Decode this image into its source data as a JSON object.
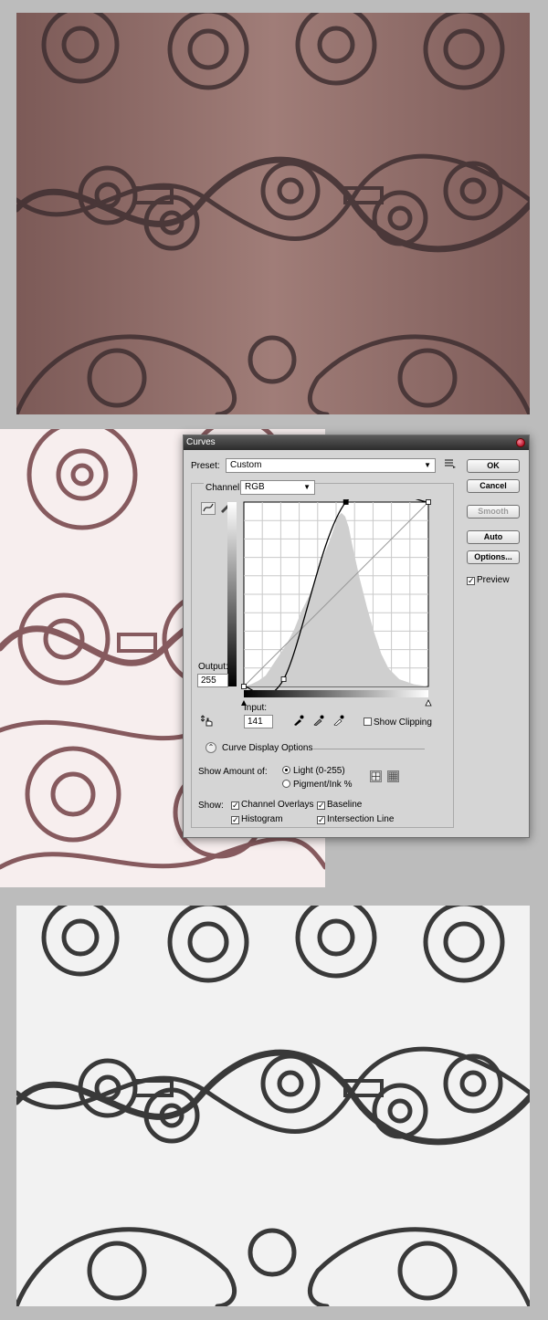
{
  "dialog": {
    "title": "Curves",
    "preset_label": "Preset:",
    "preset_value": "Custom",
    "channel_label": "Channel:",
    "channel_value": "RGB",
    "output_label": "Output:",
    "output_value": "255",
    "input_label": "Input:",
    "input_value": "141",
    "show_clipping_label": "Show Clipping",
    "show_clipping_checked": false,
    "curve_display_options_label": "Curve Display Options",
    "show_amount_label": "Show Amount of:",
    "light_label": "Light  (0-255)",
    "pigment_label": "Pigment/Ink %",
    "light_selected": true,
    "show_label": "Show:",
    "channel_overlays_label": "Channel Overlays",
    "channel_overlays_checked": true,
    "baseline_label": "Baseline",
    "baseline_checked": true,
    "histogram_label": "Histogram",
    "histogram_checked": true,
    "intersection_line_label": "Intersection Line",
    "intersection_line_checked": true,
    "preview_label": "Preview",
    "preview_checked": true
  },
  "buttons": {
    "ok": "OK",
    "cancel": "Cancel",
    "smooth": "Smooth",
    "auto": "Auto",
    "options": "Options..."
  },
  "curve": {
    "points": [
      [
        0,
        0
      ],
      [
        55,
        10
      ],
      [
        141,
        255
      ],
      [
        255,
        255
      ]
    ],
    "selected_point_index": 2
  },
  "icons": {
    "preset_menu": "list-menu-icon",
    "curve_tool": "curve-tool-icon",
    "pencil_tool": "pencil-icon",
    "hand_tool": "on-image-adjust-icon",
    "black_eyedropper": "eyedropper-black-icon",
    "gray_eyedropper": "eyedropper-gray-icon",
    "white_eyedropper": "eyedropper-white-icon"
  },
  "colors": {
    "original_wood": "#8e6a66",
    "brightened_background": "#f7eeee",
    "bw_background": "#f2f2f2",
    "dialog_background": "#d5d5d5",
    "histogram_fill": "#cfcfcf"
  }
}
